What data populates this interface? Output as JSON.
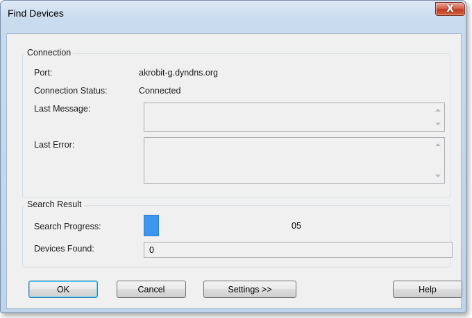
{
  "window": {
    "title": "Find Devices",
    "close_glyph": "X"
  },
  "connection": {
    "group_label": "Connection",
    "port_label": "Port:",
    "port_value": "akrobit-g.dyndns.org",
    "status_label": "Connection Status:",
    "status_value": "Connected",
    "last_message_label": "Last Message:",
    "last_message_value": "",
    "last_error_label": "Last Error:",
    "last_error_value": ""
  },
  "search_result": {
    "group_label": "Search Result",
    "progress_label": "Search Progress:",
    "progress_text": "05",
    "progress_fraction": 0.05,
    "devices_found_label": "Devices Found:",
    "devices_found_value": "0"
  },
  "buttons": {
    "ok": "OK",
    "cancel": "Cancel",
    "settings": "Settings >>",
    "help": "Help"
  },
  "colors": {
    "progress_fill": "#3d95ef",
    "close_button": "#c13b22",
    "title_bar": "#c9dbef"
  },
  "icons": {
    "close": "close-icon",
    "scroll_up": "scroll-up-arrow-icon",
    "scroll_down": "scroll-down-arrow-icon"
  }
}
